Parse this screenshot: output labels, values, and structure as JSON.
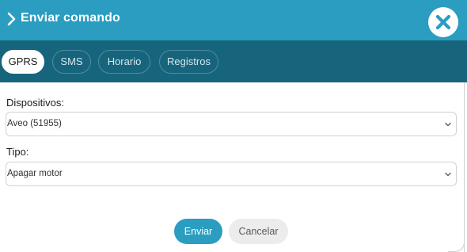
{
  "dialog": {
    "title": "Enviar comando",
    "icons": {
      "title": "chevron-right-icon",
      "close": "close-icon"
    }
  },
  "tabs": [
    {
      "label": "GPRS",
      "active": true
    },
    {
      "label": "SMS",
      "active": false
    },
    {
      "label": "Horario",
      "active": false
    },
    {
      "label": "Registros",
      "active": false
    }
  ],
  "form": {
    "devices_label": "Dispositivos:",
    "devices_value": "Aveo (51955)",
    "type_label": "Tipo:",
    "type_value": "Apagar motor"
  },
  "actions": {
    "send": "Enviar",
    "cancel": "Cancelar"
  },
  "colors": {
    "header": "#2a9dc1",
    "tabbar": "#17657c",
    "primary_button": "#2a9dc1",
    "secondary_button": "#ececec"
  }
}
